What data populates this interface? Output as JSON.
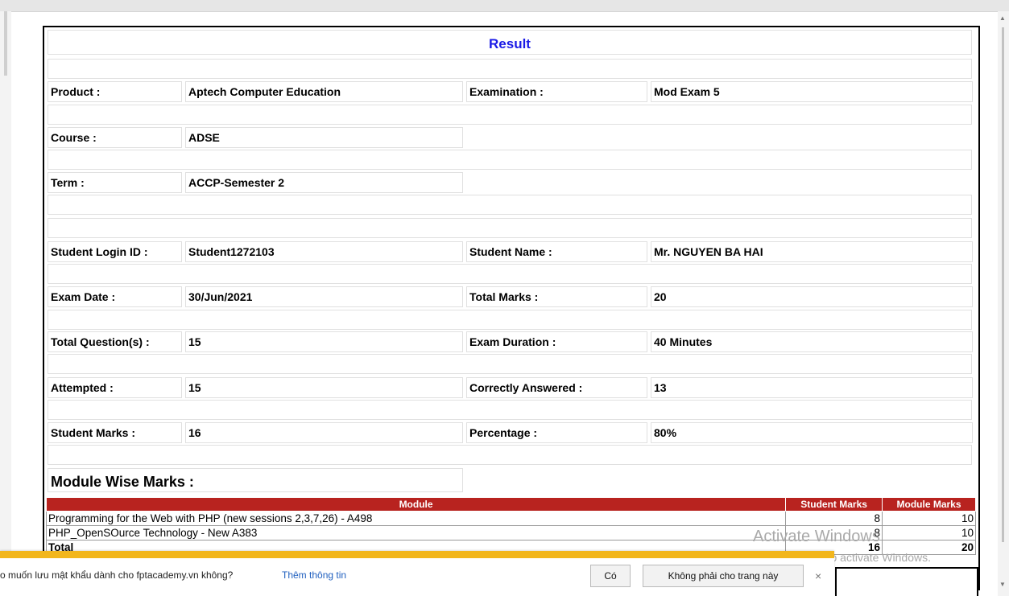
{
  "page": {
    "title": "Result",
    "rows": [
      {
        "label": "Product :",
        "value": "Aptech Computer Education",
        "label2": "Examination :",
        "value2": "Mod Exam 5"
      },
      {
        "label": "Course :",
        "value": "ADSE"
      },
      {
        "label": "Term :",
        "value": "ACCP-Semester 2"
      },
      {
        "label": "Student Login ID :",
        "value": "Student1272103",
        "label2": "Student Name :",
        "value2": "Mr. NGUYEN BA HAI"
      },
      {
        "label": "Exam Date :",
        "value": "30/Jun/2021",
        "label2": "Total Marks :",
        "value2": "20"
      },
      {
        "label": "Total Question(s) :",
        "value": "15",
        "label2": "Exam Duration :",
        "value2": "40 Minutes"
      },
      {
        "label": "Attempted :",
        "value": "15",
        "label2": "Correctly Answered :",
        "value2": "13"
      },
      {
        "label": "Student Marks :",
        "value": "16",
        "label2": "Percentage :",
        "value2": "80%"
      }
    ],
    "module_wise_label": "Module Wise Marks :",
    "module_table": {
      "headers": [
        "Module",
        "Student Marks",
        "Module Marks"
      ],
      "rows": [
        {
          "module": "Programming for the Web with PHP (new sessions 2,3,7,26) - A498",
          "student": "8",
          "max": "10"
        },
        {
          "module": "PHP_OpenSOurce Technology - New A383",
          "student": "8",
          "max": "10"
        },
        {
          "module": "Total",
          "student": "16",
          "max": "20"
        }
      ]
    }
  },
  "watermark": {
    "line1": "Activate Windows",
    "line2": "Go to Settings to activate Windows."
  },
  "password_bar": {
    "message": "o muốn lưu mật khẩu dành cho fptacademy.vn không?",
    "more_link": "Thêm thông tin",
    "yes_button": "Có",
    "no_button": "Không phải cho trang này",
    "close_symbol": "×"
  },
  "scroll_arrows": {
    "up": "▲",
    "down": "▼"
  }
}
